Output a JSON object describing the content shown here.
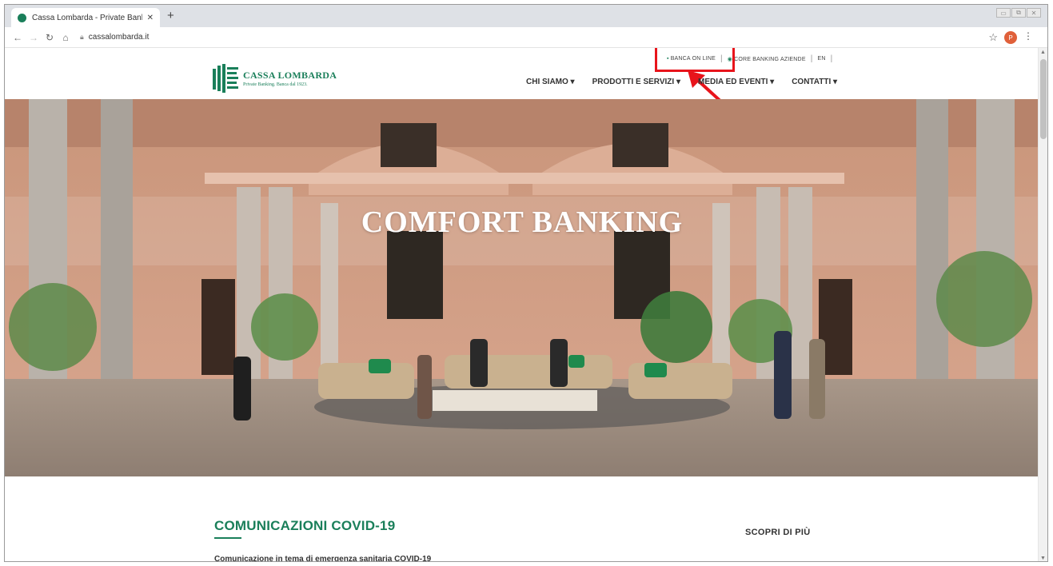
{
  "browser": {
    "tab_title": "Cassa Lombarda - Private Bankin",
    "tab_close": "✕",
    "new_tab": "+",
    "url": "cassalombarda.it",
    "profile_initial": "P",
    "window_controls": [
      "▭",
      "⧉",
      "✕"
    ]
  },
  "utility_links": {
    "banca_online": "BANCA ON LINE",
    "core_banking": "CORE BANKING AZIENDE",
    "language": "EN"
  },
  "logo": {
    "name": "CASSA LOMBARDA",
    "tagline": "Private Banking. Banca dal 1923."
  },
  "nav": {
    "items": [
      {
        "label": "CHI SIAMO ▾"
      },
      {
        "label": "PRODOTTI E SERVIZI ▾"
      },
      {
        "label": "MEDIA ED EVENTI ▾"
      },
      {
        "label": "CONTATTI ▾"
      }
    ]
  },
  "hero": {
    "title": "COMFORT BANKING"
  },
  "content": {
    "covid_heading": "COMUNICAZIONI COVID-19",
    "covid_text": "Comunicazione in tema di emergenza sanitaria COVID-19",
    "scopri": "SCOPRI DI PIÙ"
  },
  "colors": {
    "brand_green": "#1a7f5a",
    "highlight_red": "#e8141b"
  }
}
